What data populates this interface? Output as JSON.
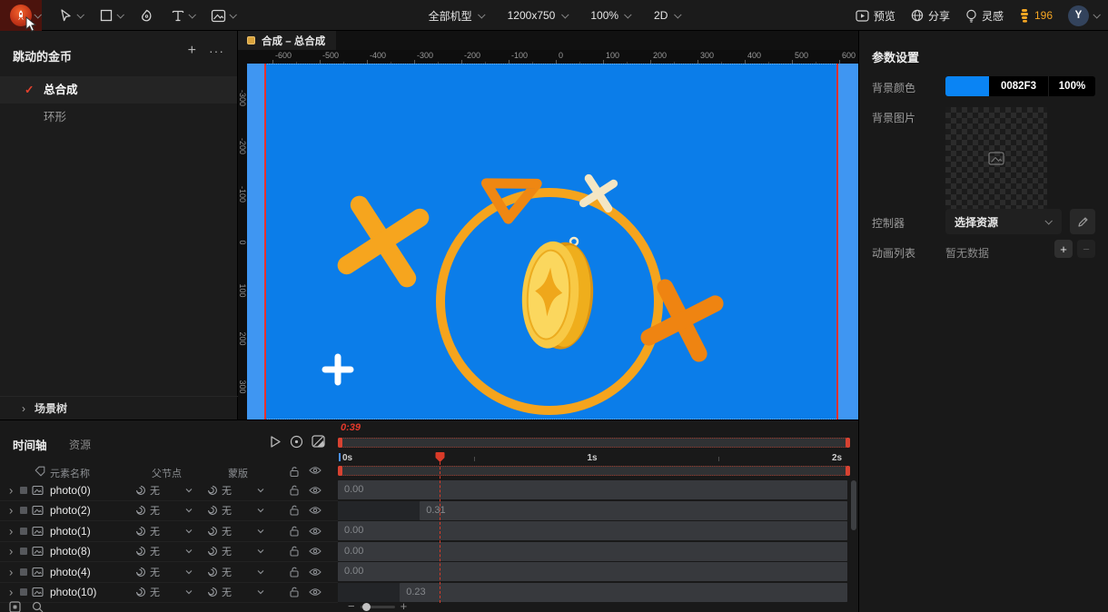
{
  "topbar": {
    "device_label": "全部机型",
    "resolution_label": "1200x750",
    "zoom_label": "100%",
    "mode_label": "2D",
    "preview_label": "预览",
    "share_label": "分享",
    "inspiration_label": "灵感",
    "credits_count": "196",
    "avatar_initial": "Y"
  },
  "left_panel": {
    "title": "跳动的金币",
    "items": [
      {
        "label": "总合成",
        "selected": true
      },
      {
        "label": "环形",
        "selected": false
      }
    ],
    "scene_tree_label": "场景树"
  },
  "canvas": {
    "tab_label": "合成 – 总合成",
    "h_ruler_labels": [
      "-600",
      "-500",
      "-400",
      "-300",
      "-200",
      "-100",
      "0",
      "100",
      "200",
      "300",
      "400",
      "500",
      "600"
    ],
    "v_ruler_labels": [
      "-300",
      "-200",
      "-100",
      "0",
      "100",
      "200",
      "300"
    ]
  },
  "right_panel": {
    "title": "参数设置",
    "bg_color": {
      "label": "背景颜色",
      "hex": "0082F3",
      "opacity": "100%",
      "swatch": "#0A84F4"
    },
    "bg_image": {
      "label": "背景图片"
    },
    "controller": {
      "label": "控制器",
      "value": "选择资源"
    },
    "anim_list": {
      "label": "动画列表",
      "empty_text": "暂无数据"
    }
  },
  "timeline": {
    "tab_timeline": "时间轴",
    "tab_resources": "资源",
    "time_display": "0:39",
    "playhead_time_s": 0.39,
    "ruler_labels": [
      {
        "label": "0s",
        "t": 0
      },
      {
        "label": "1s",
        "t": 1
      },
      {
        "label": "2s",
        "t": 2
      }
    ],
    "columns": {
      "name": "元素名称",
      "parent": "父节点",
      "mask": "蒙版"
    },
    "rows": [
      {
        "name": "photo(0)",
        "parent": "无",
        "mask": "无",
        "value": "0.00",
        "start_s": 0
      },
      {
        "name": "photo(2)",
        "parent": "无",
        "mask": "无",
        "value": "0.31",
        "start_s": 0.31
      },
      {
        "name": "photo(1)",
        "parent": "无",
        "mask": "无",
        "value": "0.00",
        "start_s": 0
      },
      {
        "name": "photo(8)",
        "parent": "无",
        "mask": "无",
        "value": "0.00",
        "start_s": 0
      },
      {
        "name": "photo(4)",
        "parent": "无",
        "mask": "无",
        "value": "0.00",
        "start_s": 0
      },
      {
        "name": "photo(10)",
        "parent": "无",
        "mask": "无",
        "value": "0.23",
        "start_s": 0.23
      }
    ]
  },
  "colors": {
    "canvas_blue": "#0B7DE9",
    "canvas_blue_outer": "#3F96F2",
    "accent_orange": "#F5A623",
    "accent_orange_dark": "#EF8411",
    "accent_red": "#E23B2E"
  }
}
